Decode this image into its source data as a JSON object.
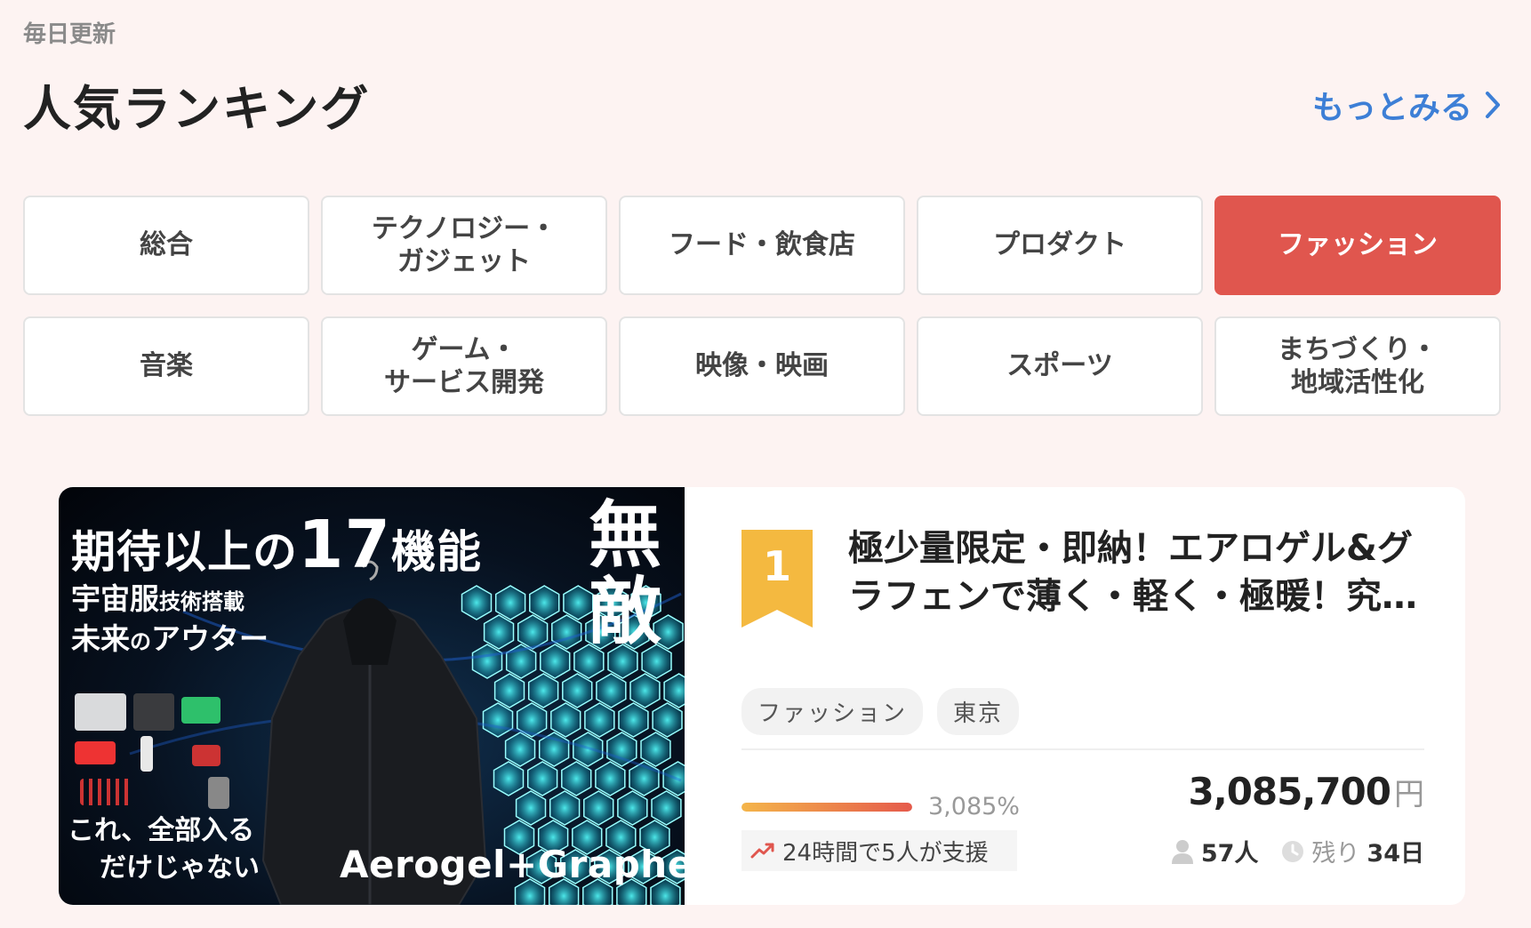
{
  "header": {
    "update_label": "毎日更新",
    "title": "人気ランキング",
    "more_link": "もっとみる"
  },
  "categories": [
    {
      "label": "総合",
      "active": false
    },
    {
      "label": "テクノロジー・\nガジェット",
      "active": false
    },
    {
      "label": "フード・飲食店",
      "active": false
    },
    {
      "label": "プロダクト",
      "active": false
    },
    {
      "label": "ファッション",
      "active": true
    },
    {
      "label": "音楽",
      "active": false
    },
    {
      "label": "ゲーム・\nサービス開発",
      "active": false
    },
    {
      "label": "映像・映画",
      "active": false
    },
    {
      "label": "スポーツ",
      "active": false
    },
    {
      "label": "まちづくり・\n地域活性化",
      "active": false
    }
  ],
  "project": {
    "rank": "1",
    "title": "極少量限定・即納！エアロゲル&グラフェンで薄く・軽く・極暖！究…",
    "tags": [
      "ファッション",
      "東京"
    ],
    "progress_percent_label": "3,085%",
    "progress_fill": 1.0,
    "amount": "3,085,700",
    "amount_unit": "円",
    "trend_text": "24時間で5人が支援",
    "supporters": "57人",
    "remaining_label": "残り",
    "remaining_days": "34日",
    "image": {
      "headline_prefix": "期待以上の",
      "headline_number": "17",
      "headline_suffix": "機能",
      "sub_line1_main": "宇宙服",
      "sub_line1_small": "技術搭載",
      "sub_line2_main": "未来",
      "sub_line2_small": "の",
      "sub_line2_end": "アウター",
      "vertical_1": "無",
      "vertical_2": "敵",
      "bottom_line1": "これ、全部入る",
      "bottom_line2": "だけじゃない",
      "brand": "Aerogel+Graphene"
    }
  },
  "colors": {
    "background": "#fdf3f2",
    "accent": "#e0564e",
    "link": "#3d7fd6",
    "rank_badge": "#f4b940"
  }
}
